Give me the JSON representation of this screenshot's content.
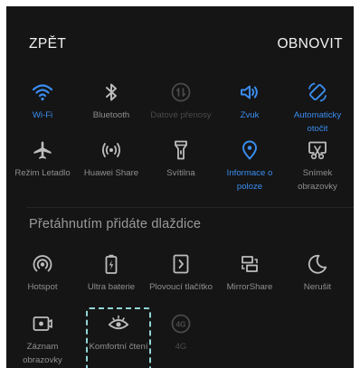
{
  "header": {
    "back_label": "ZPĚT",
    "refresh_label": "OBNOVIT"
  },
  "colors": {
    "background": "#151515",
    "active": "#3a8ef2",
    "inactive": "#bdbdbd",
    "disabled": "#4a4a4a",
    "highlight_outline": "#93d6d6"
  },
  "active_tiles": [
    {
      "label": "Wi-Fi",
      "icon": "wifi-icon",
      "state": "on"
    },
    {
      "label": "Bluetooth",
      "icon": "bluetooth-icon",
      "state": "off"
    },
    {
      "label": "Datové přenosy",
      "icon": "mobile-data-icon",
      "state": "disabled"
    },
    {
      "label": "Zvuk",
      "icon": "sound-icon",
      "state": "on"
    },
    {
      "label": "Automaticky otočit",
      "icon": "auto-rotate-icon",
      "state": "on"
    },
    {
      "label": "Režim Letadlo",
      "icon": "airplane-icon",
      "state": "off"
    },
    {
      "label": "Huawei Share",
      "icon": "huawei-share-icon",
      "state": "off"
    },
    {
      "label": "Svítilna",
      "icon": "flashlight-icon",
      "state": "off"
    },
    {
      "label": "Informace o poloze",
      "icon": "location-icon",
      "state": "on"
    },
    {
      "label": "Snímek obrazovky",
      "icon": "screenshot-icon",
      "state": "off"
    }
  ],
  "available_section": {
    "title": "Přetáhnutím přidáte dlaždice",
    "tiles": [
      {
        "label": "Hotspot",
        "icon": "hotspot-icon",
        "state": "off"
      },
      {
        "label": "Ultra baterie",
        "icon": "ultra-battery-icon",
        "state": "off"
      },
      {
        "label": "Plovoucí tlačítko",
        "icon": "floating-button-icon",
        "state": "off"
      },
      {
        "label": "MirrorShare",
        "icon": "mirrorshare-icon",
        "state": "off"
      },
      {
        "label": "Nerušit",
        "icon": "do-not-disturb-icon",
        "state": "off"
      },
      {
        "label": "Záznam obrazovky",
        "icon": "screen-record-icon",
        "state": "off"
      },
      {
        "label": "Komfortní čtení",
        "icon": "eye-comfort-icon",
        "state": "off"
      },
      {
        "label": "4G",
        "icon": "4g-icon",
        "state": "disabled"
      }
    ]
  }
}
